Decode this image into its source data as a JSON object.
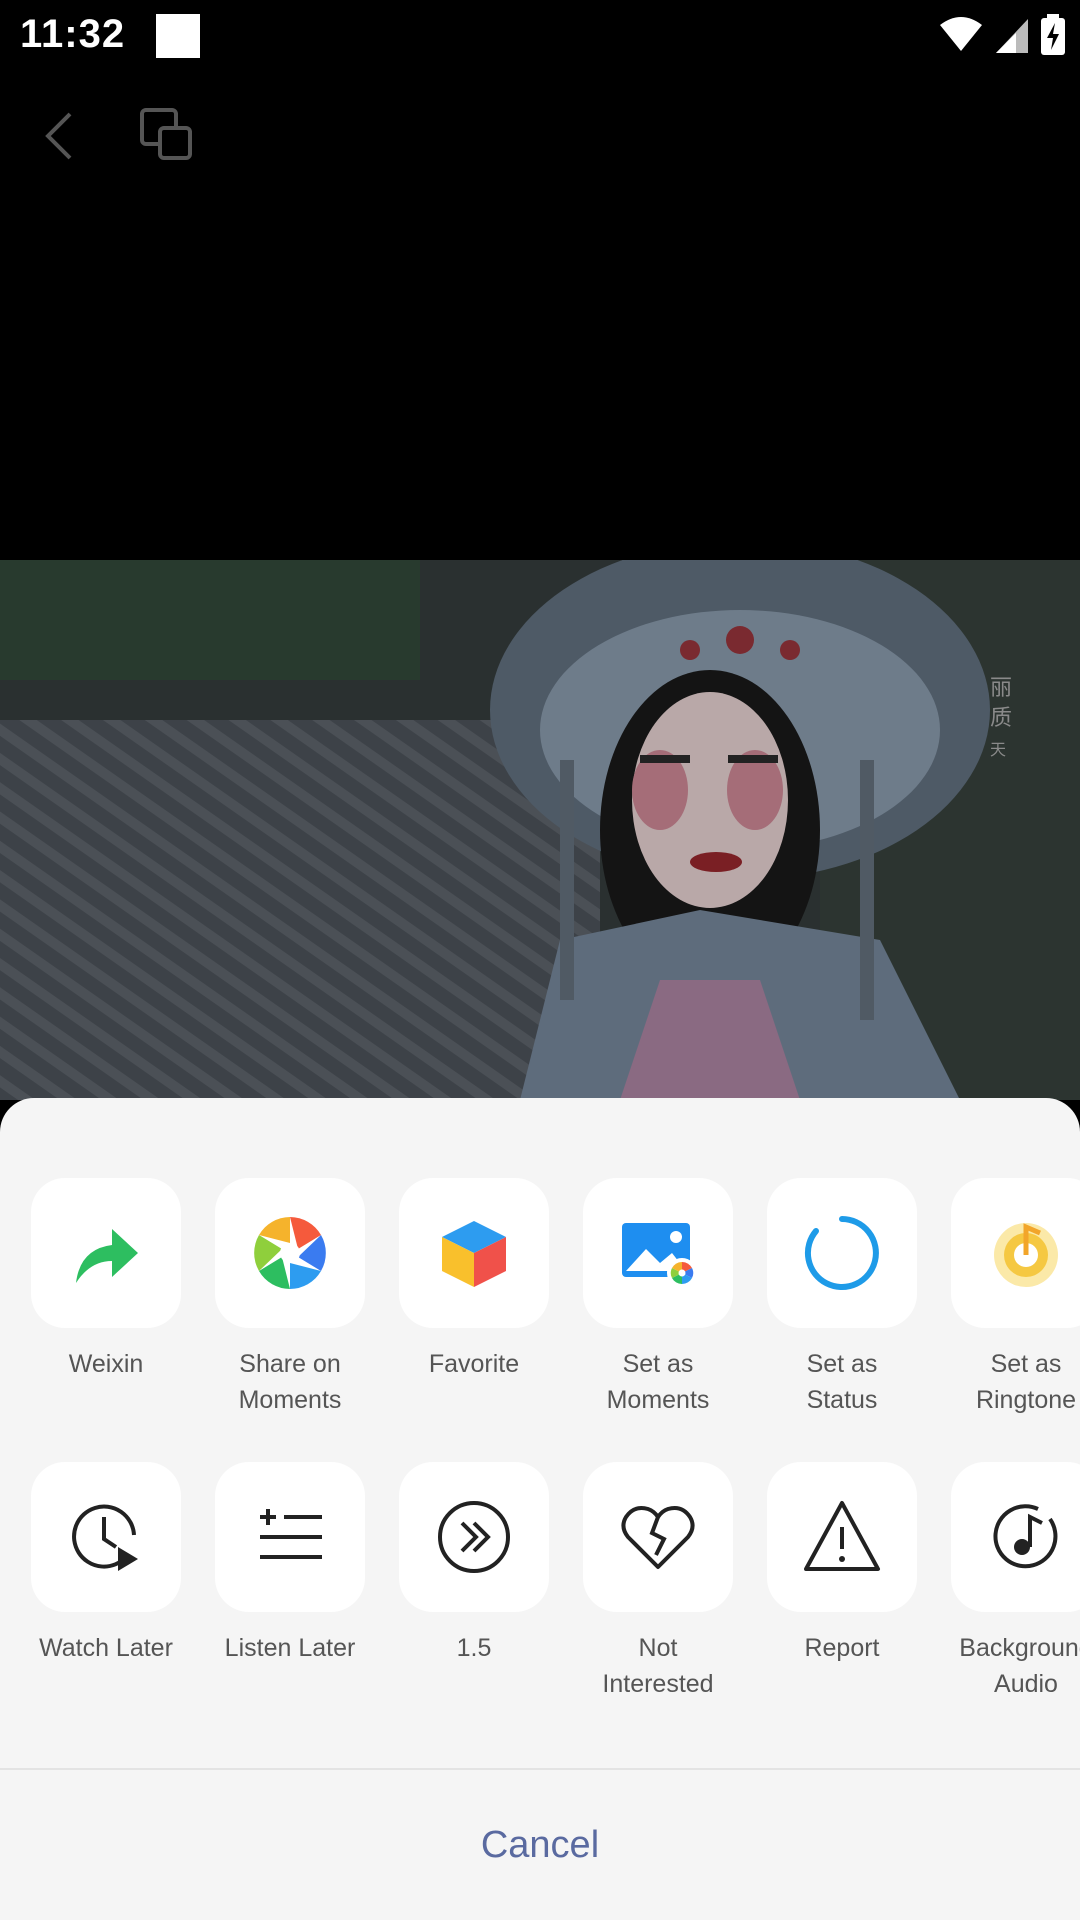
{
  "status_bar": {
    "time": "11:32"
  },
  "share_row": [
    {
      "label": "Weixin",
      "icon": "weixin-share-icon"
    },
    {
      "label": "Share on\nMoments",
      "icon": "moments-icon"
    },
    {
      "label": "Favorite",
      "icon": "favorite-cube-icon"
    },
    {
      "label": "Set as\nMoments",
      "icon": "set-moments-image-icon"
    },
    {
      "label": "Set as\nStatus",
      "icon": "status-ring-icon"
    },
    {
      "label": "Set as\nRingtone",
      "icon": "ringtone-icon"
    }
  ],
  "action_row": [
    {
      "label": "Watch Later",
      "icon": "watch-later-icon"
    },
    {
      "label": "Listen Later",
      "icon": "listen-later-icon"
    },
    {
      "label": "1.5",
      "icon": "playback-speed-icon"
    },
    {
      "label": "Not\nInterested",
      "icon": "broken-heart-icon"
    },
    {
      "label": "Report",
      "icon": "warning-icon"
    },
    {
      "label": "Background\nAudio",
      "icon": "music-note-icon"
    }
  ],
  "cancel_label": "Cancel",
  "colors": {
    "accent_green": "#2dbe60",
    "status_blue": "#1e9be8",
    "cancel_text": "#5a6aa0",
    "sheet_bg": "#f5f5f5"
  }
}
